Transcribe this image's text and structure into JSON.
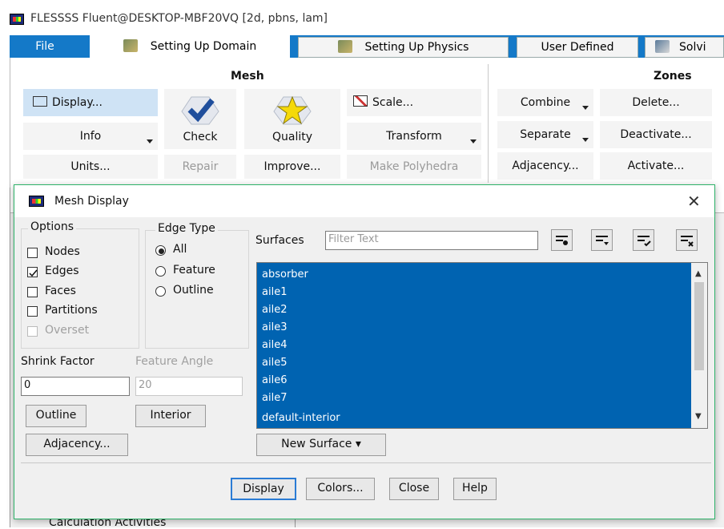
{
  "window": {
    "title": "FLESSSS Fluent@DESKTOP-MBF20VQ  [2d, pbns, lam]"
  },
  "ribbon": {
    "tabs": [
      "File",
      "Setting Up Domain",
      "Setting Up Physics",
      "User Defined",
      "Solvi"
    ],
    "mesh_group": {
      "title": "Mesh",
      "display": "Display...",
      "info": "Info",
      "units": "Units...",
      "check": "Check",
      "repair": "Repair",
      "quality": "Quality",
      "improve": "Improve...",
      "scale": "Scale...",
      "transform": "Transform",
      "make_polyhedra": "Make Polyhedra"
    },
    "zones_group": {
      "title": "Zones",
      "combine": "Combine",
      "delete": "Delete...",
      "separate": "Separate",
      "deactivate": "Deactivate...",
      "adjacency": "Adjacency...",
      "activate": "Activate..."
    }
  },
  "background": {
    "tree_item": "Calculation Activities"
  },
  "dialog": {
    "title": "Mesh Display",
    "options": {
      "label": "Options",
      "items": [
        {
          "label": "Nodes",
          "checked": false,
          "enabled": true
        },
        {
          "label": "Edges",
          "checked": true,
          "enabled": true
        },
        {
          "label": "Faces",
          "checked": false,
          "enabled": true
        },
        {
          "label": "Partitions",
          "checked": false,
          "enabled": true
        },
        {
          "label": "Overset",
          "checked": false,
          "enabled": false
        }
      ]
    },
    "edge_type": {
      "label": "Edge Type",
      "items": [
        "All",
        "Feature",
        "Outline"
      ],
      "selected": "All"
    },
    "shrink_factor": {
      "label": "Shrink Factor",
      "value": "0"
    },
    "feature_angle": {
      "label": "Feature Angle",
      "value": "20"
    },
    "outline_button": "Outline",
    "interior_button": "Interior",
    "adjacency_button": "Adjacency...",
    "surfaces": {
      "label": "Surfaces",
      "placeholder": "Filter Text",
      "items": [
        "absorber",
        "aile1",
        "aile2",
        "aile3",
        "aile4",
        "aile5",
        "aile6",
        "aile7",
        "default-interior"
      ]
    },
    "new_surface_button": "New Surface ▾",
    "footer_buttons": {
      "display": "Display",
      "colors": "Colors...",
      "close": "Close",
      "help": "Help"
    }
  }
}
